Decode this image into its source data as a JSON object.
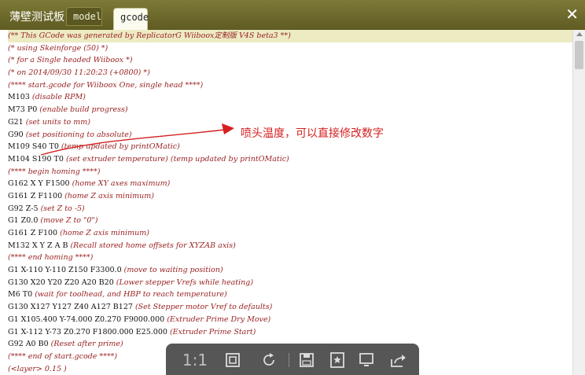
{
  "window": {
    "title": "薄壁测试板",
    "tabs": [
      {
        "label": "model",
        "active": false
      },
      {
        "label": "gcode",
        "active": true
      }
    ],
    "close_icon": "close-icon"
  },
  "annotation": {
    "text": "喷头温度，可以直接修改数字",
    "color": "#d42020"
  },
  "gcode_lines": [
    {
      "code": "",
      "comment": "(** This GCode was generated by ReplicatorG Wiiboox定制版 V4S beta3 **)",
      "highlight": true
    },
    {
      "code": "",
      "comment": "(*  using Skeinforge (50)  *)"
    },
    {
      "code": "",
      "comment": "(*  for a Single headed Wiiboox  *)"
    },
    {
      "code": "",
      "comment": "(*  on 2014/09/30 11:20:23 (+0800) *)"
    },
    {
      "code": "",
      "comment": "(**** start.gcode for Wiiboox One, single head ****)"
    },
    {
      "code": "M103 ",
      "comment": "(disable RPM)"
    },
    {
      "code": "M73 P0 ",
      "comment": "(enable build progress)"
    },
    {
      "code": "G21 ",
      "comment": "(set units to mm)"
    },
    {
      "code": "G90 ",
      "comment": "(set positioning to absolute)"
    },
    {
      "code": "M109 S40 T0 ",
      "comment": "(temp updated by printOMatic)"
    },
    {
      "code": "M104 S190 T0 ",
      "comment": "(set extruder temperature) (temp updated by printOMatic)"
    },
    {
      "code": "",
      "comment": "(**** begin homing ****)"
    },
    {
      "code": "G162 X Y F1500 ",
      "comment": "(home XY axes maximum)"
    },
    {
      "code": "G161 Z F1100 ",
      "comment": "(home Z axis minimum)"
    },
    {
      "code": "G92 Z-5 ",
      "comment": "(set Z to -5)"
    },
    {
      "code": "G1 Z0.0 ",
      "comment": "(move Z to \"0\")"
    },
    {
      "code": "G161 Z F100 ",
      "comment": "(home Z axis minimum)"
    },
    {
      "code": "M132 X Y Z A B ",
      "comment": "(Recall stored home offsets for XYZAB axis)"
    },
    {
      "code": "",
      "comment": "(**** end homing ****)"
    },
    {
      "code": "G1 X-110 Y-110 Z150 F3300.0 ",
      "comment": "(move to waiting position)"
    },
    {
      "code": "G130 X20 Y20 Z20 A20 B20 ",
      "comment": "(Lower stepper Vrefs while heating)"
    },
    {
      "code": "M6 T0 ",
      "comment": "(wait for toolhead, and HBP to reach temperature)"
    },
    {
      "code": "G130 X127 Y127 Z40 A127 B127 ",
      "comment": "(Set Stepper motor Vref to defaults)"
    },
    {
      "code": "G1 X105.400 Y-74.000 Z0.270 F9000.000 ",
      "comment": "(Extruder Prime Dry Move)"
    },
    {
      "code": "G1 X-112 Y-73 Z0.270 F1800.000 E25.000 ",
      "comment": "(Extruder Prime Start)"
    },
    {
      "code": "G92 A0 B0 ",
      "comment": "(Reset after prime)"
    },
    {
      "code": "",
      "comment": "(**** end of start.gcode ****)"
    },
    {
      "code": "",
      "comment": "(<layer> 0.15 )"
    }
  ],
  "toolbar": {
    "one_to_one_label": "1:1",
    "icons": [
      "fit-screen-icon",
      "rotate-icon",
      "save-icon",
      "bookmark-icon",
      "screen-icon",
      "share-icon"
    ]
  }
}
